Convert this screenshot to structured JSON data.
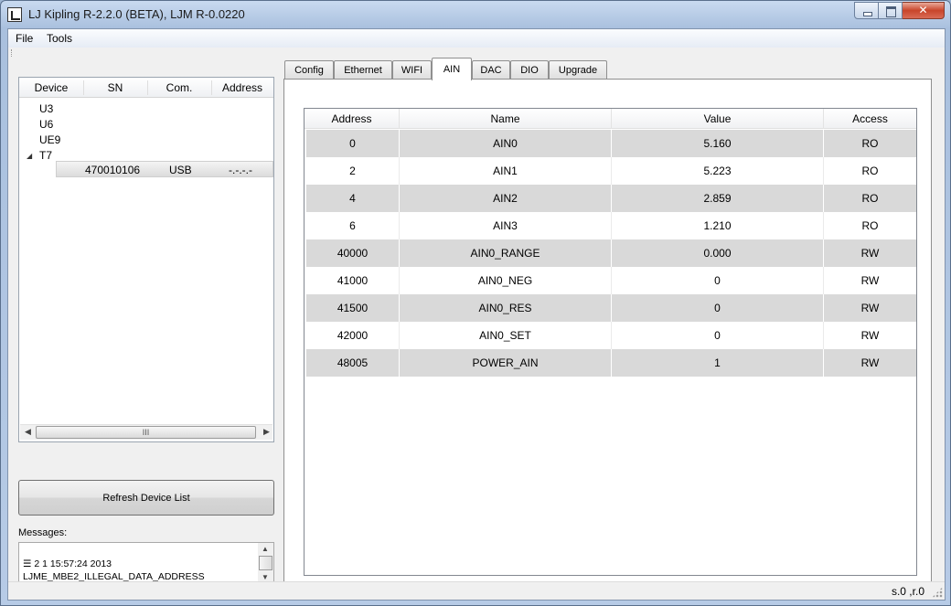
{
  "window": {
    "title": "LJ Kipling R-2.2.0 (BETA), LJM R-0.0220"
  },
  "menu": {
    "file": "File",
    "tools": "Tools"
  },
  "device_tree": {
    "columns": [
      "Device",
      "SN",
      "Com.",
      "Address"
    ],
    "devices": [
      "U3",
      "U6",
      "UE9",
      "T7"
    ],
    "selected_child": {
      "sn": "470010106",
      "com": "USB",
      "address": "-.-.-.-"
    },
    "scroll_grip": "III"
  },
  "buttons": {
    "refresh": "Refresh Device List"
  },
  "messages": {
    "label": "Messages:",
    "lines": [
      "2 1 15:57:24 2013",
      "LJME_MBE2_ILLEGAL_DATA_ADDRESS"
    ]
  },
  "tabs": [
    "Config",
    "Ethernet",
    "WIFI",
    "AIN",
    "DAC",
    "DIO",
    "Upgrade"
  ],
  "active_tab": "AIN",
  "register_table": {
    "columns": [
      "Address",
      "Name",
      "Value",
      "Access"
    ],
    "rows": [
      {
        "address": "0",
        "name": "AIN0",
        "value": "5.160",
        "access": "RO"
      },
      {
        "address": "2",
        "name": "AIN1",
        "value": "5.223",
        "access": "RO"
      },
      {
        "address": "4",
        "name": "AIN2",
        "value": "2.859",
        "access": "RO"
      },
      {
        "address": "6",
        "name": "AIN3",
        "value": "1.210",
        "access": "RO"
      },
      {
        "address": "40000",
        "name": "AIN0_RANGE",
        "value": "0.000",
        "access": "RW"
      },
      {
        "address": "41000",
        "name": "AIN0_NEG",
        "value": "0",
        "access": "RW"
      },
      {
        "address": "41500",
        "name": "AIN0_RES",
        "value": "0",
        "access": "RW"
      },
      {
        "address": "42000",
        "name": "AIN0_SET",
        "value": "0",
        "access": "RW"
      },
      {
        "address": "48005",
        "name": "POWER_AIN",
        "value": "1",
        "access": "RW"
      }
    ]
  },
  "status": {
    "text": "s.0 ,r.0"
  }
}
